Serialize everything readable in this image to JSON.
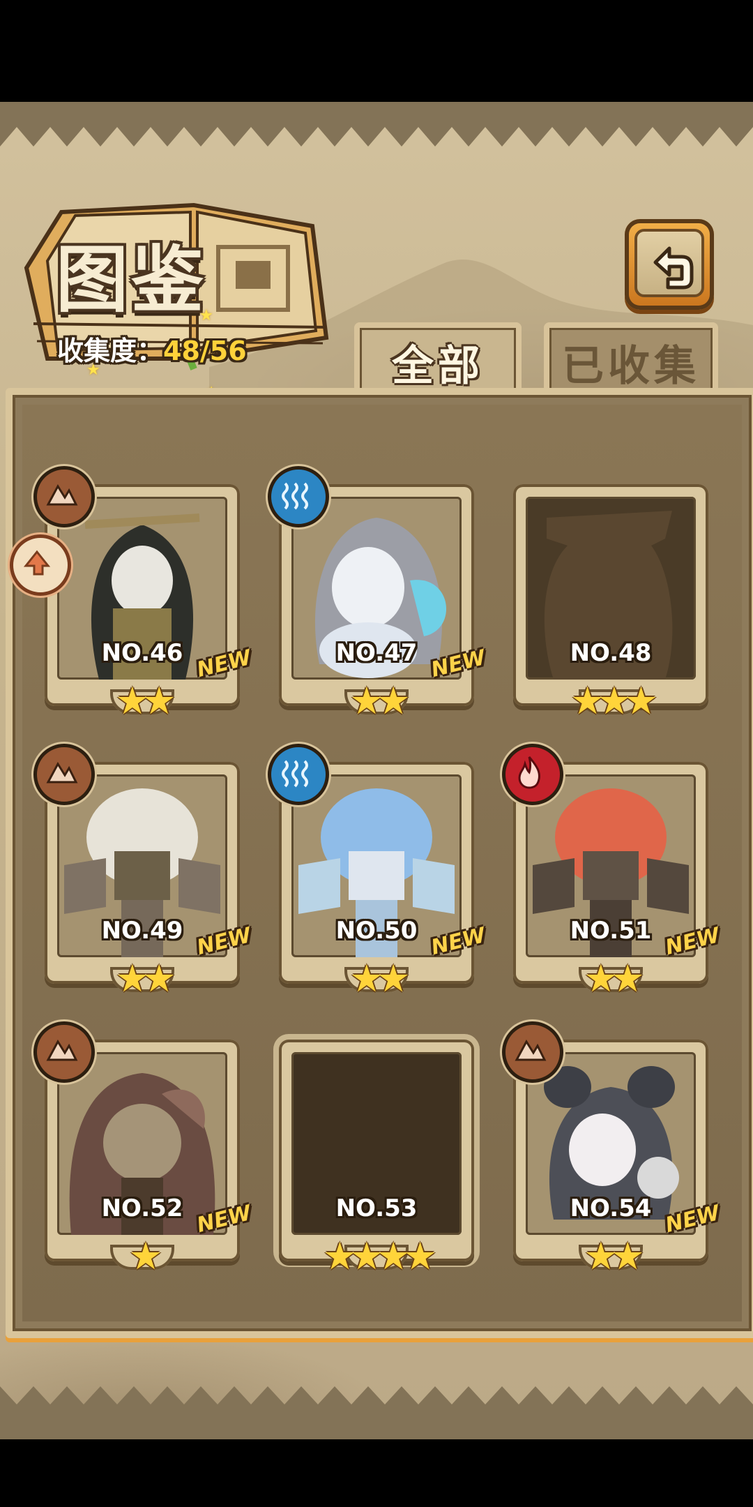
{
  "header": {
    "title": "图鉴",
    "collect_label": "收集度：",
    "collect_count": "48/56"
  },
  "tabs": [
    {
      "label": "全部",
      "active": true
    },
    {
      "label": "已收集",
      "active": false
    }
  ],
  "cards": [
    {
      "number": "NO.46",
      "stars": "★★",
      "new": "NEW",
      "element": "earth-icon"
    },
    {
      "number": "NO.47",
      "stars": "★★",
      "new": "NEW",
      "element": "water-icon"
    },
    {
      "number": "NO.48",
      "stars": "★★★",
      "new": "",
      "element": ""
    },
    {
      "number": "NO.49",
      "stars": "★★",
      "new": "NEW",
      "element": "earth-icon"
    },
    {
      "number": "NO.50",
      "stars": "★★",
      "new": "NEW",
      "element": "water-icon"
    },
    {
      "number": "NO.51",
      "stars": "★★",
      "new": "NEW",
      "element": "fire-icon"
    },
    {
      "number": "NO.52",
      "stars": "★",
      "new": "NEW",
      "element": "earth-icon"
    },
    {
      "number": "NO.53",
      "stars": "★★★★",
      "new": "",
      "element": ""
    },
    {
      "number": "NO.54",
      "stars": "★★",
      "new": "NEW",
      "element": "earth-icon"
    }
  ],
  "colors": {
    "star": "#ffd43a",
    "new_badge": "#ffd34a",
    "earth": "#9a5a36",
    "water": "#2c86c4",
    "fire": "#c4212b"
  }
}
